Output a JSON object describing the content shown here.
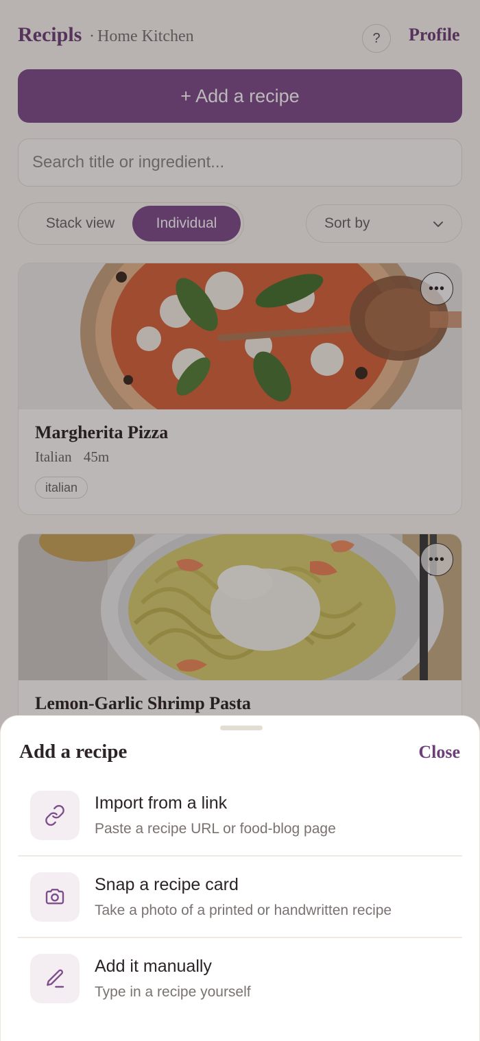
{
  "header": {
    "brand": "Recipls",
    "separator": "·",
    "subtitle": "Home Kitchen",
    "help_label": "?",
    "profile_label": "Profile"
  },
  "add_button": {
    "icon": "plus-icon",
    "label": "+ Add a recipe"
  },
  "search": {
    "placeholder": "Search title or ingredient...",
    "value": ""
  },
  "view_toggle": {
    "options": [
      "Stack view",
      "Individual"
    ],
    "selected": "Individual"
  },
  "sort": {
    "label": "Sort by",
    "icon": "chevron-down-icon"
  },
  "recipes": [
    {
      "title": "Margherita Pizza",
      "cuisine": "Italian",
      "time": "45m",
      "tag": "italian",
      "image": "pizza-photo"
    },
    {
      "title": "Lemon-Garlic Shrimp Pasta",
      "image": "shrimp-pasta-photo"
    }
  ],
  "sheet": {
    "title": "Add a recipe",
    "close_label": "Close",
    "options": [
      {
        "icon": "link-icon",
        "label": "Import from a link",
        "description": "Paste a recipe URL or food-blog page"
      },
      {
        "icon": "camera-icon",
        "label": "Snap a recipe card",
        "description": "Take a photo of a printed or handwritten recipe"
      },
      {
        "icon": "pencil-icon",
        "label": "Add it manually",
        "description": "Type in a recipe yourself"
      }
    ]
  },
  "colors": {
    "accent": "#7e4d8c",
    "brand_text": "#6d3f78",
    "background": "#fbf7f1",
    "overlay": "rgba(30,24,26,0.30)"
  }
}
